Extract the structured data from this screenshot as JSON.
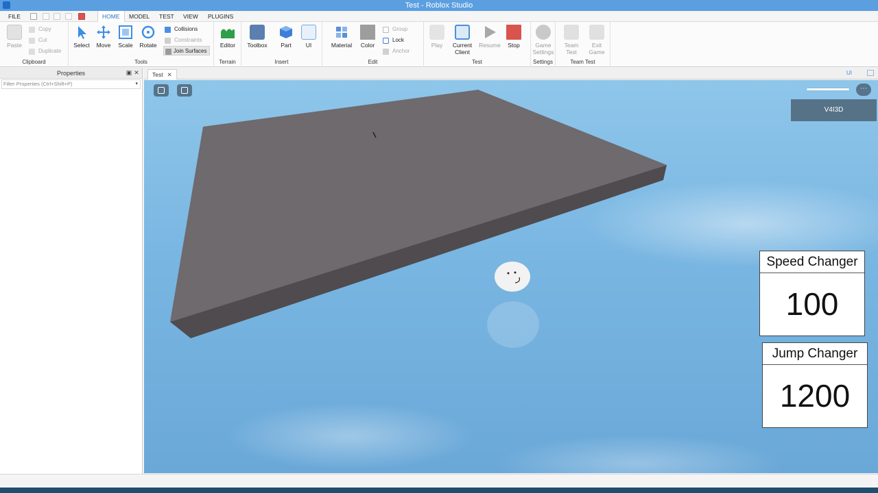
{
  "window": {
    "title": "Test - Roblox Studio"
  },
  "menu": {
    "file": "FILE",
    "tabs": [
      "HOME",
      "MODEL",
      "TEST",
      "VIEW",
      "PLUGINS"
    ],
    "active_tab": "HOME"
  },
  "ribbon": {
    "clipboard": {
      "label": "Clipboard",
      "paste": "Paste",
      "copy": "Copy",
      "cut": "Cut",
      "duplicate": "Duplicate"
    },
    "tools": {
      "label": "Tools",
      "select": "Select",
      "move": "Move",
      "scale": "Scale",
      "rotate": "Rotate",
      "collisions": "Collisions",
      "constraints": "Constraints",
      "join_surfaces": "Join Surfaces"
    },
    "terrain": {
      "label": "Terrain",
      "editor": "Editor"
    },
    "insert": {
      "label": "Insert",
      "toolbox": "Toolbox",
      "part": "Part",
      "ui": "UI"
    },
    "edit": {
      "label": "Edit",
      "material": "Material",
      "color": "Color",
      "group": "Group",
      "lock": "Lock",
      "anchor": "Anchor"
    },
    "test": {
      "label": "Test",
      "play": "Play",
      "current_client": "Current",
      "current_client_2": "Client",
      "resume": "Resume",
      "stop": "Stop"
    },
    "settings": {
      "label": "Settings",
      "game_settings": "Game",
      "game_settings_2": "Settings"
    },
    "team_test": {
      "label": "Team Test",
      "team_test": "Team",
      "team_test_2": "Test",
      "exit_game": "Exit",
      "exit_game_2": "Game"
    }
  },
  "properties": {
    "title": "Properties",
    "filter_placeholder": "Filter Properties (Ctrl+Shift+P)"
  },
  "document": {
    "tab_label": "Test",
    "ui_toggle": "UI"
  },
  "viewport": {
    "username": "V4I3D",
    "speed_panel": {
      "title": "Speed Changer",
      "value": "100"
    },
    "jump_panel": {
      "title": "Jump Changer",
      "value": "1200"
    }
  },
  "colors": {
    "accent": "#2a6fc9",
    "titlebar": "#5b9fe1",
    "baseplate": "#6e6a6d",
    "sky": "#79b6e2"
  }
}
